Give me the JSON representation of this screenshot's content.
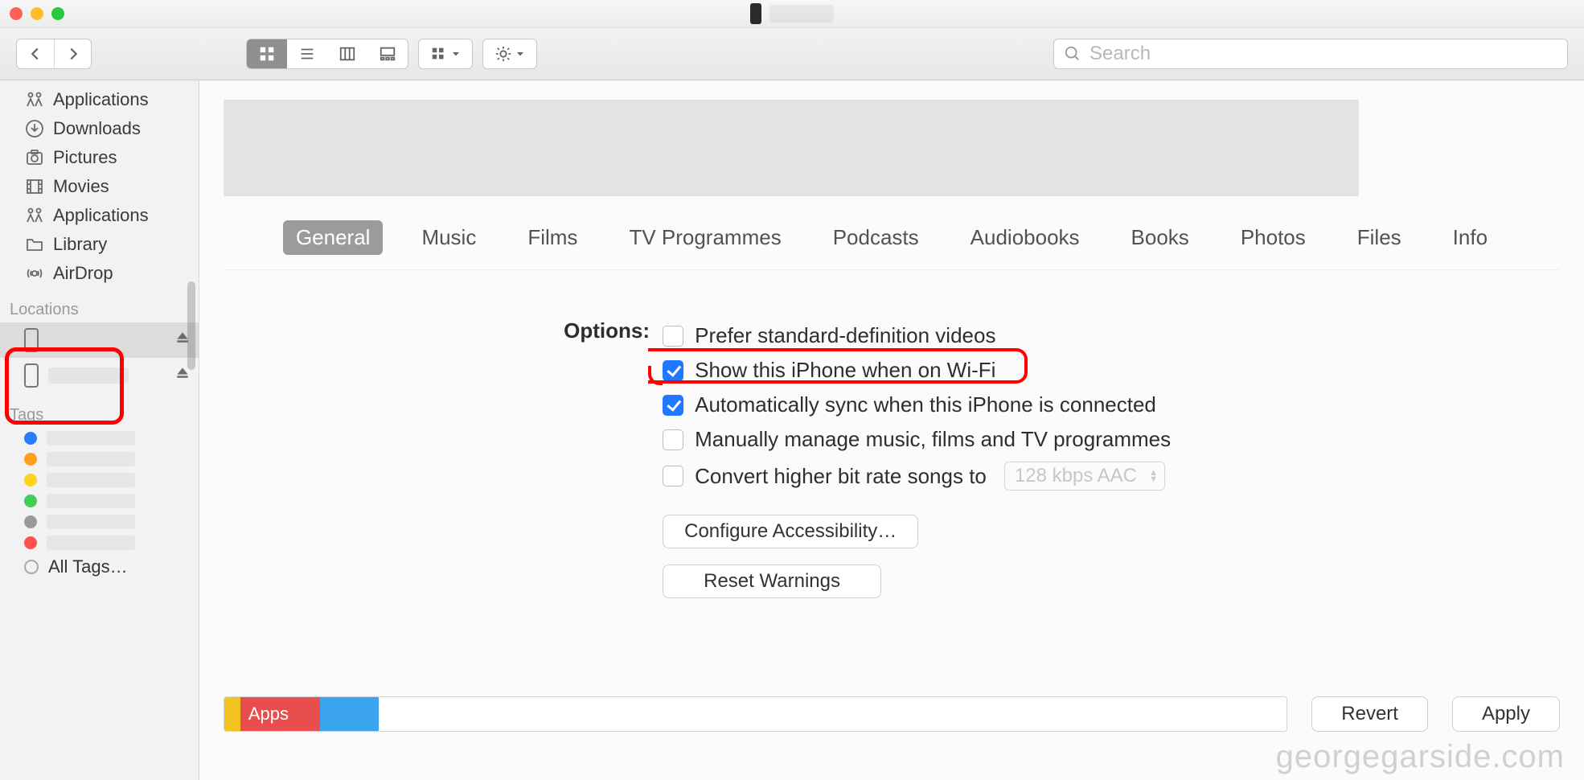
{
  "search": {
    "placeholder": "Search"
  },
  "sidebar": {
    "favorites": [
      {
        "icon": "applications-icon",
        "label": "Applications"
      },
      {
        "icon": "downloads-icon",
        "label": "Downloads"
      },
      {
        "icon": "pictures-icon",
        "label": "Pictures"
      },
      {
        "icon": "movies-icon",
        "label": "Movies"
      },
      {
        "icon": "applications-icon",
        "label": "Applications"
      },
      {
        "icon": "folder-icon",
        "label": "Library"
      },
      {
        "icon": "airdrop-icon",
        "label": "AirDrop"
      }
    ],
    "locations_header": "Locations",
    "tags_header": "Tags",
    "tag_colors": [
      "#2a7cff",
      "#ff9f1f",
      "#ffd31f",
      "#46cc56",
      "#9a9a9a",
      "#ff524f"
    ],
    "all_tags_label": "All Tags…"
  },
  "tabs": [
    "General",
    "Music",
    "Films",
    "TV Programmes",
    "Podcasts",
    "Audiobooks",
    "Books",
    "Photos",
    "Files",
    "Info"
  ],
  "options": {
    "label": "Options:",
    "items": [
      {
        "label": "Prefer standard-definition videos",
        "checked": false
      },
      {
        "label": "Show this iPhone when on Wi-Fi",
        "checked": true
      },
      {
        "label": "Automatically sync when this iPhone is connected",
        "checked": true
      },
      {
        "label": "Manually manage music, films and TV programmes",
        "checked": false
      },
      {
        "label": "Convert higher bit rate songs to",
        "checked": false
      }
    ],
    "bitrate_value": "128 kbps AAC",
    "configure_label": "Configure Accessibility…",
    "reset_label": "Reset Warnings"
  },
  "capacity": {
    "apps_label": "Apps",
    "segments": [
      {
        "color": "#f3c320",
        "pct": 1.5
      },
      {
        "color": "#e84e4e",
        "pct": 7.5
      },
      {
        "color": "#3aa4ef",
        "pct": 5.5
      }
    ]
  },
  "actions": {
    "revert": "Revert",
    "apply": "Apply"
  },
  "watermark": "georgegarside.com"
}
